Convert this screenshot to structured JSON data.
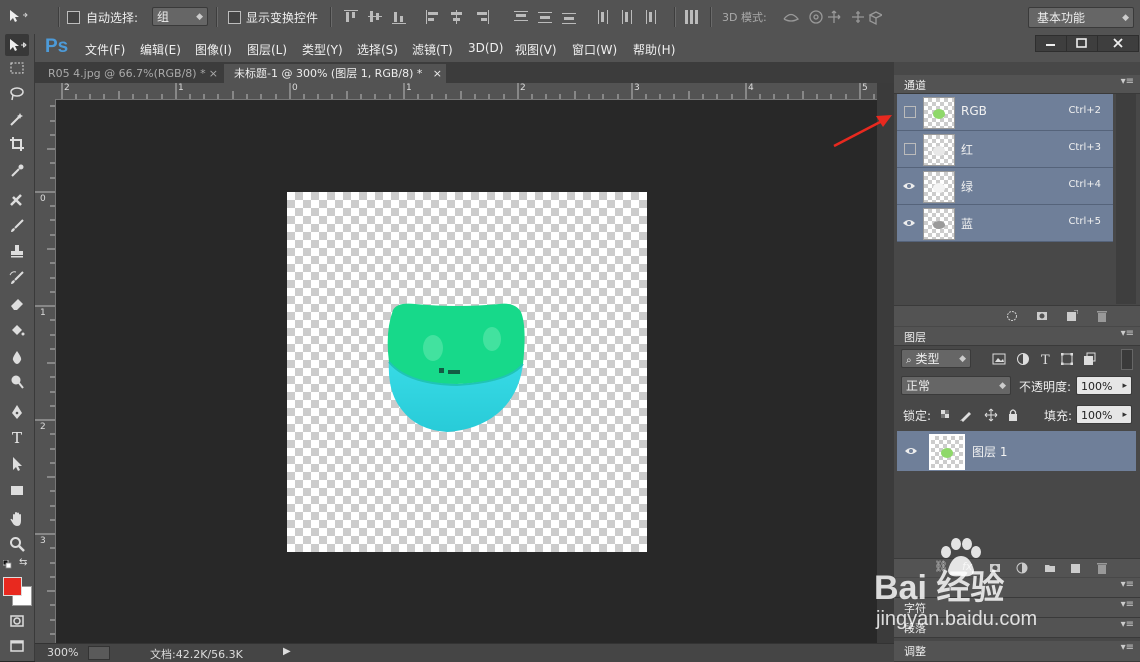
{
  "options_bar": {
    "auto_select_label": "自动选择:",
    "auto_select_value": "组",
    "show_transform_label": "显示变换控件",
    "mode_3d_label": "3D 模式:",
    "workspace_value": "基本功能"
  },
  "menubar": {
    "logo": "Ps",
    "items": [
      "文件(F)",
      "编辑(E)",
      "图像(I)",
      "图层(L)",
      "类型(Y)",
      "选择(S)",
      "滤镜(T)",
      "3D(D)",
      "视图(V)",
      "窗口(W)",
      "帮助(H)"
    ]
  },
  "tabs": [
    {
      "label": "R05 4.jpg @ 66.7%(RGB/8) *",
      "close": "×"
    },
    {
      "label": "未标题-1 @ 300% (图层 1, RGB/8) *",
      "close": "×"
    }
  ],
  "rulers": {
    "h_ticks": [
      "2",
      "1",
      "0",
      "1",
      "2",
      "3",
      "4",
      "5"
    ],
    "v_ticks": [
      "0",
      "1",
      "2",
      "3"
    ]
  },
  "status": {
    "zoom": "300%",
    "doc_size": "文档:42.2K/56.3K"
  },
  "channels_panel": {
    "title": "通道",
    "channels": [
      {
        "name": "RGB",
        "shortcut": "Ctrl+2",
        "visible": false
      },
      {
        "name": "红",
        "shortcut": "Ctrl+3",
        "visible": false
      },
      {
        "name": "绿",
        "shortcut": "Ctrl+4",
        "visible": true
      },
      {
        "name": "蓝",
        "shortcut": "Ctrl+5",
        "visible": true
      }
    ]
  },
  "layers_panel": {
    "title": "图层",
    "filter_label": "类型",
    "blend_mode": "正常",
    "opacity_label": "不透明度:",
    "opacity_value": "100%",
    "lock_label": "锁定:",
    "fill_label": "填充:",
    "fill_value": "100%",
    "layers": [
      {
        "name": "图层 1",
        "visible": true
      }
    ]
  },
  "collapsed_panels": [
    "字符",
    "段落",
    "调整"
  ],
  "watermark": {
    "brand": "Bai 经验",
    "url": "jingyan.baidu.com"
  },
  "colors": {
    "foreground": "#e8291f",
    "background": "#ffffff",
    "object_top": "#17d98a",
    "object_bottom": "#31d6e0",
    "selection_highlight": "#6f7f99",
    "arrow": "#e8291f"
  }
}
